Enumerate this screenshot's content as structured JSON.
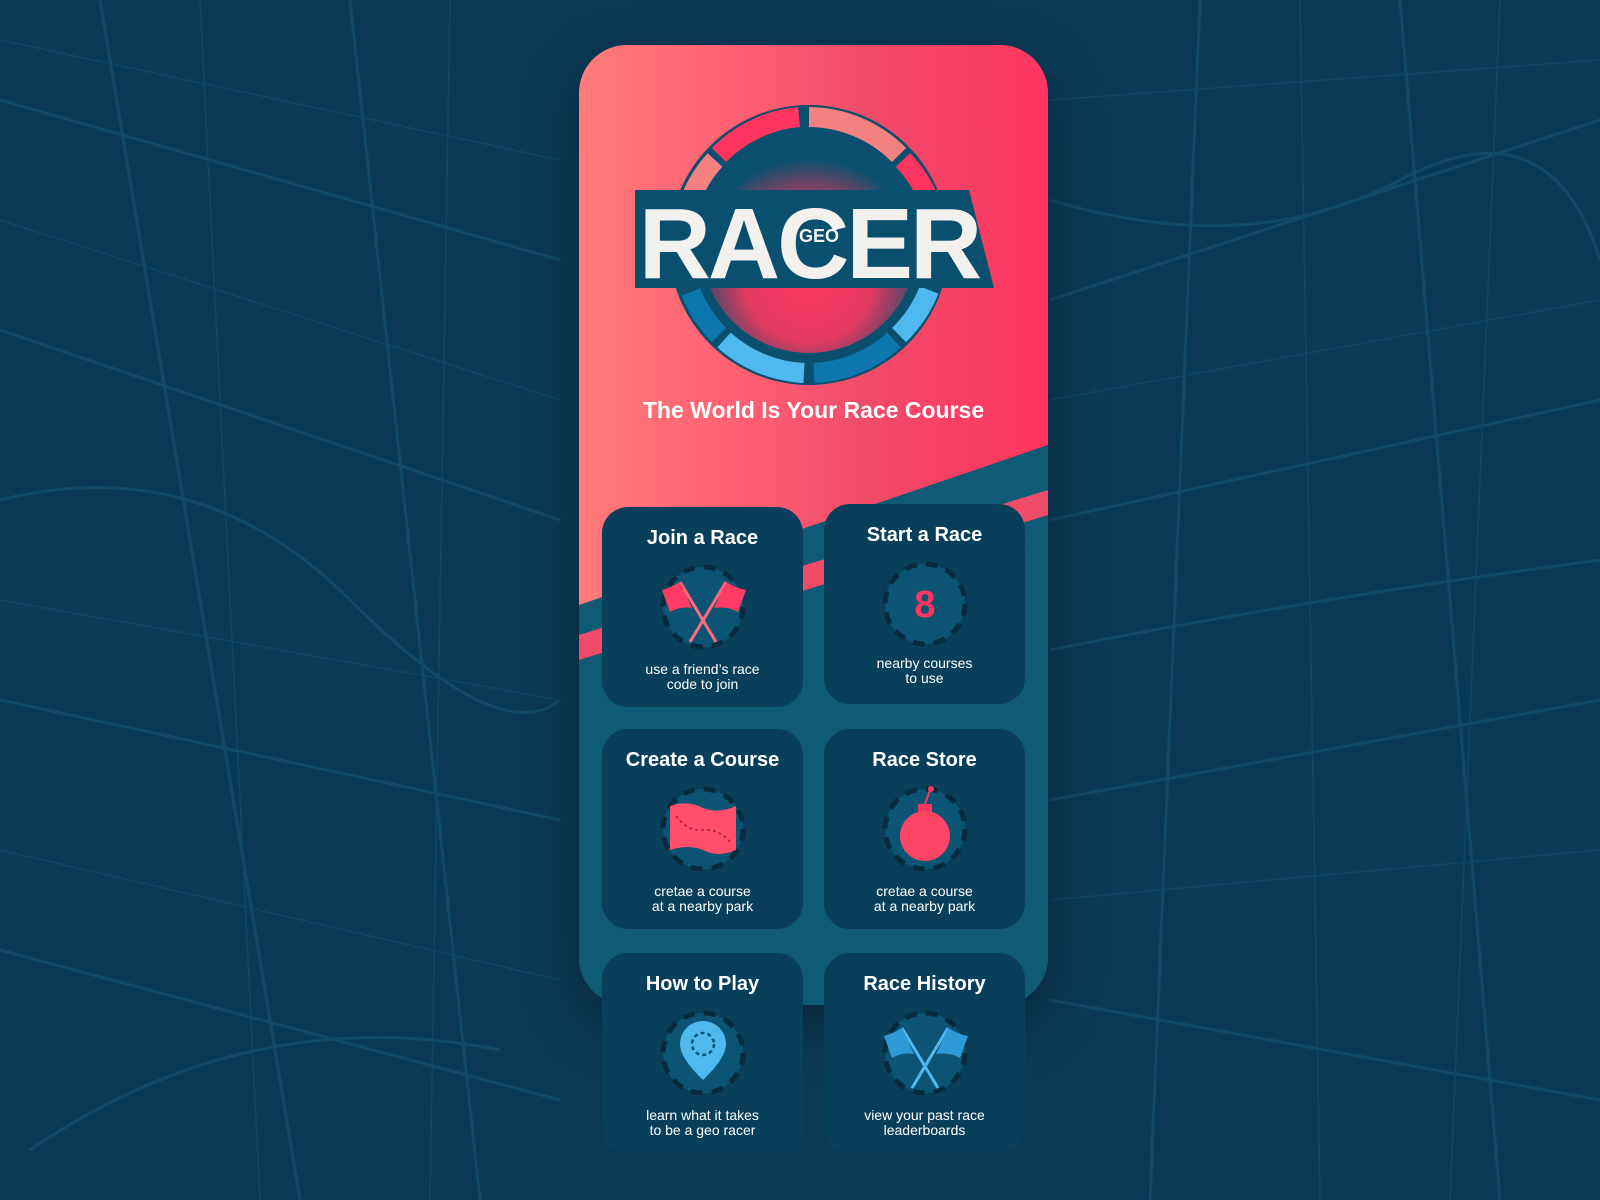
{
  "logo": {
    "word": "RACER",
    "sub": "GEO"
  },
  "tagline": "The World Is Your Race Course",
  "cards": [
    {
      "title": "Join a Race",
      "desc": "use a friend’s race\ncode to join",
      "icon": "crossed-flags-icon"
    },
    {
      "title": "Start a Race",
      "desc": "nearby courses\nto use",
      "icon": "count-badge",
      "count": "8"
    },
    {
      "title": "Create a Course",
      "desc": "cretae a course\nat a nearby park",
      "icon": "map-icon"
    },
    {
      "title": "Race Store",
      "desc": "cretae a course\nat a nearby park",
      "icon": "bomb-icon"
    },
    {
      "title": "How to Play",
      "desc": "learn what it takes\nto be a geo racer",
      "icon": "location-pin-icon"
    },
    {
      "title": "Race History",
      "desc": "view your past race\nleaderboards",
      "icon": "crossed-flags-blue-icon"
    }
  ],
  "colors": {
    "bg": "#0b3a57",
    "accent": "#ff3560",
    "card": "#093f5a",
    "blue": "#4fb8ef"
  }
}
